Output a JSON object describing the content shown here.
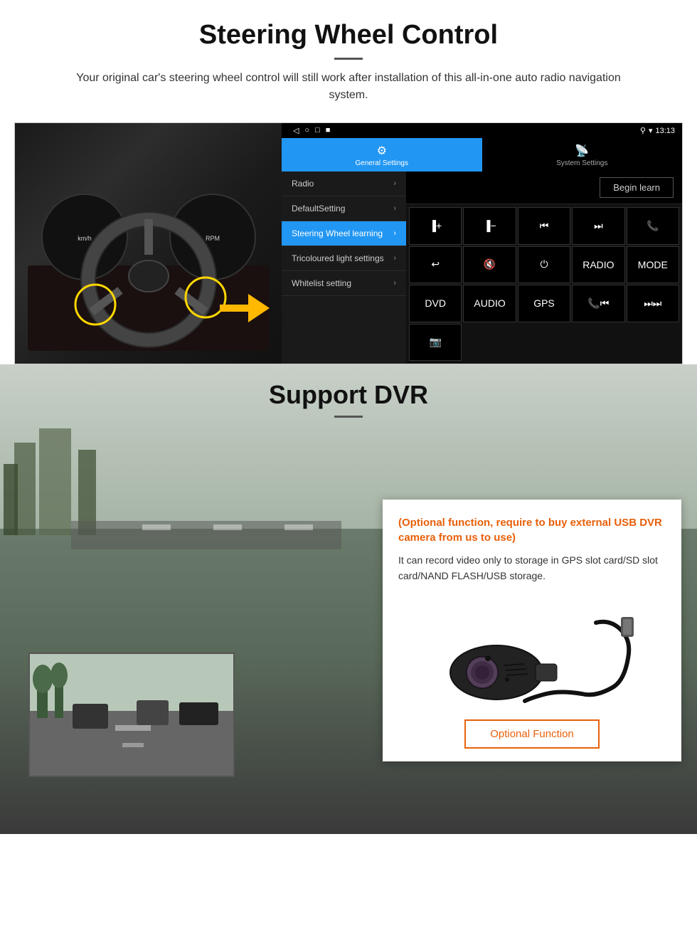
{
  "steering_section": {
    "title": "Steering Wheel Control",
    "description": "Your original car's steering wheel control will still work after installation of this all-in-one auto radio navigation system.",
    "android_ui": {
      "status_bar": {
        "time": "13:13",
        "nav_icons": [
          "◁",
          "○",
          "□",
          "■"
        ]
      },
      "tabs": [
        {
          "label": "General Settings",
          "icon": "⚙",
          "active": true
        },
        {
          "label": "System Settings",
          "icon": "📡",
          "active": false
        }
      ],
      "menu_items": [
        {
          "label": "Radio",
          "active": false
        },
        {
          "label": "DefaultSetting",
          "active": false
        },
        {
          "label": "Steering Wheel learning",
          "active": true
        },
        {
          "label": "Tricoloured light settings",
          "active": false
        },
        {
          "label": "Whitelist setting",
          "active": false
        }
      ],
      "begin_learn_label": "Begin learn",
      "control_buttons": [
        {
          "label": "▐+",
          "row": 1
        },
        {
          "label": "▐−",
          "row": 1
        },
        {
          "label": "⏮",
          "row": 1
        },
        {
          "label": "⏭",
          "row": 1
        },
        {
          "label": "📞",
          "row": 1
        },
        {
          "label": "↩",
          "row": 2
        },
        {
          "label": "🔇",
          "row": 2
        },
        {
          "label": "⏻",
          "row": 2
        },
        {
          "label": "RADIO",
          "row": 2
        },
        {
          "label": "MODE",
          "row": 2
        },
        {
          "label": "DVD",
          "row": 3
        },
        {
          "label": "AUDIO",
          "row": 3
        },
        {
          "label": "GPS",
          "row": 3
        },
        {
          "label": "📞⏮",
          "row": 3
        },
        {
          "label": "⏭⏭",
          "row": 3
        },
        {
          "label": "📷",
          "row": 4
        }
      ]
    }
  },
  "dvr_section": {
    "title": "Support DVR",
    "optional_text": "(Optional function, require to buy external USB DVR camera from us to use)",
    "description": "It can record video only to storage in GPS slot card/SD slot card/NAND FLASH/USB storage.",
    "optional_function_btn_label": "Optional Function"
  }
}
